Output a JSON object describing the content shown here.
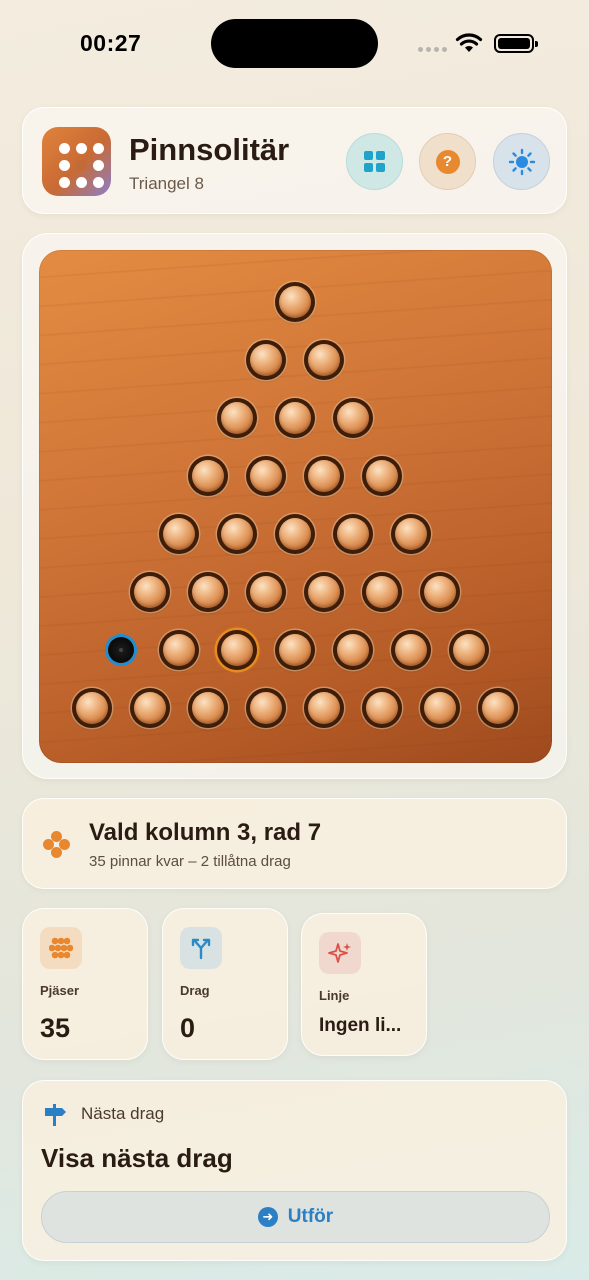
{
  "status_bar": {
    "time": "00:27"
  },
  "header": {
    "title": "Pinnsolitär",
    "subtitle": "Triangel 8",
    "buttons": {
      "grid": "grid-icon",
      "help": "?",
      "theme": "sun-icon"
    }
  },
  "colors": {
    "accent_orange": "#e8872d",
    "accent_blue": "#2b7fc4",
    "board_wood": "#cd7236",
    "selected_ring": "#e58b1f",
    "empty_ring": "#1e8fd4"
  },
  "board": {
    "rows": 8,
    "empty": [
      [
        7,
        1
      ]
    ],
    "selected": [
      7,
      3
    ]
  },
  "info": {
    "title": "Vald kolumn 3, rad 7",
    "subtitle": "35 pinnar kvar – 2 tillåtna drag"
  },
  "stats": [
    {
      "label": "Pjäser",
      "value": "35",
      "icon": "pieces-icon"
    },
    {
      "label": "Drag",
      "value": "0",
      "icon": "fork-icon"
    },
    {
      "label": "Linje",
      "value": "Ingen li...",
      "icon": "sparkle-icon"
    }
  ],
  "next_move": {
    "header": "Nästa drag",
    "title": "Visa nästa drag",
    "button_label": "Utför"
  }
}
